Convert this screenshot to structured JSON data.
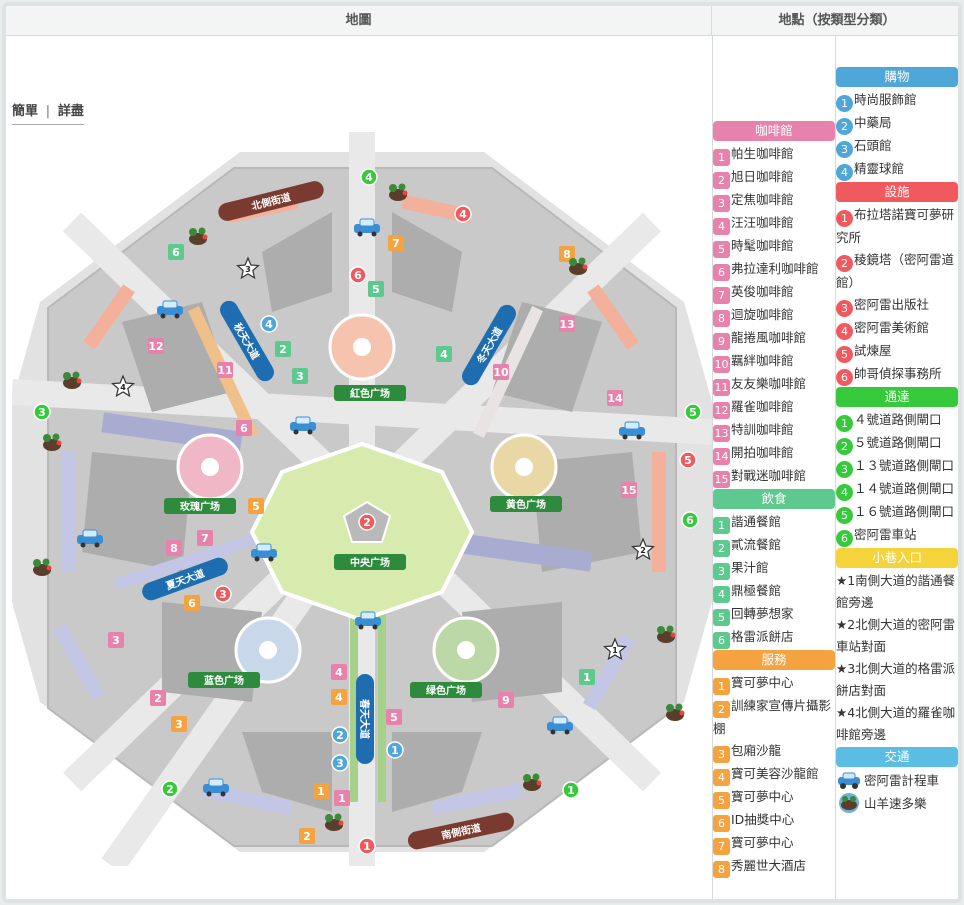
{
  "header": {
    "map_title": "地圖",
    "locations_title": "地點（按類型分類）"
  },
  "toggle": {
    "simple": "簡單",
    "sep": "|",
    "detail": "詳盡"
  },
  "map": {
    "plazas": {
      "red": "紅色广场",
      "yellow": "黄色广场",
      "rose": "玫瑰广场",
      "center": "中央广场",
      "blue": "蓝色广场",
      "green": "绿色广场"
    },
    "roads": {
      "north": "北側街道",
      "south": "南側街道",
      "autumn": "秋天大道",
      "winter": "冬天大道",
      "summer": "夏天大道",
      "spring": "春天大道"
    },
    "stars": [
      "1",
      "2",
      "3",
      "4"
    ]
  },
  "categories": [
    {
      "key": "cafe",
      "title": "咖啡館",
      "color": "#e682ab",
      "shape": "square",
      "items": [
        {
          "n": "1",
          "label": "帕生咖啡館"
        },
        {
          "n": "2",
          "label": "旭日咖啡館"
        },
        {
          "n": "3",
          "label": "定焦咖啡館"
        },
        {
          "n": "4",
          "label": "汪汪咖啡館"
        },
        {
          "n": "5",
          "label": "時髦咖啡館"
        },
        {
          "n": "6",
          "label": "弗拉達利咖啡館"
        },
        {
          "n": "7",
          "label": "英俊咖啡館"
        },
        {
          "n": "8",
          "label": "迴旋咖啡館"
        },
        {
          "n": "9",
          "label": "龍捲風咖啡館"
        },
        {
          "n": "10",
          "label": "羈絆咖啡館"
        },
        {
          "n": "11",
          "label": "友友樂咖啡館"
        },
        {
          "n": "12",
          "label": "羅雀咖啡館"
        },
        {
          "n": "13",
          "label": "特訓咖啡館"
        },
        {
          "n": "14",
          "label": "開拍咖啡館"
        },
        {
          "n": "15",
          "label": "對戰迷咖啡館"
        }
      ]
    },
    {
      "key": "food",
      "title": "飲食",
      "color": "#5ec98e",
      "shape": "square",
      "items": [
        {
          "n": "1",
          "label": "諧通餐館"
        },
        {
          "n": "2",
          "label": "貳流餐館"
        },
        {
          "n": "3",
          "label": "果汁館"
        },
        {
          "n": "4",
          "label": "鼎極餐館"
        },
        {
          "n": "5",
          "label": "回轉夢想家"
        },
        {
          "n": "6",
          "label": "格雷派餅店"
        }
      ]
    },
    {
      "key": "service",
      "title": "服務",
      "color": "#f4a340",
      "shape": "square",
      "items": [
        {
          "n": "1",
          "label": "寶可夢中心"
        },
        {
          "n": "2",
          "label": "訓練家宣傳片攝影棚"
        },
        {
          "n": "3",
          "label": "包廂沙龍"
        },
        {
          "n": "4",
          "label": "寶可美容沙龍館"
        },
        {
          "n": "5",
          "label": "寶可夢中心"
        },
        {
          "n": "6",
          "label": "ID抽獎中心"
        },
        {
          "n": "7",
          "label": "寶可夢中心"
        },
        {
          "n": "8",
          "label": "秀麗世大酒店"
        }
      ]
    },
    {
      "key": "shop",
      "title": "購物",
      "color": "#4fa6d8",
      "shape": "circle",
      "items": [
        {
          "n": "1",
          "label": "時尚服飾館"
        },
        {
          "n": "2",
          "label": "中藥局"
        },
        {
          "n": "3",
          "label": "石頭館"
        },
        {
          "n": "4",
          "label": "精靈球館"
        }
      ]
    },
    {
      "key": "facility",
      "title": "設施",
      "color": "#f05a5f",
      "shape": "circle",
      "items": [
        {
          "n": "1",
          "label": "布拉塔諾寶可夢研究所"
        },
        {
          "n": "2",
          "label": "稜鏡塔（密阿雷道館）"
        },
        {
          "n": "3",
          "label": "密阿雷出版社"
        },
        {
          "n": "4",
          "label": "密阿雷美術館"
        },
        {
          "n": "5",
          "label": "試煉屋"
        },
        {
          "n": "6",
          "label": "帥哥偵探事務所"
        }
      ]
    },
    {
      "key": "gate",
      "title": "通達",
      "color": "#36c93b",
      "shape": "circle",
      "items": [
        {
          "n": "1",
          "label": "４號道路側閘口"
        },
        {
          "n": "2",
          "label": "５號道路側閘口"
        },
        {
          "n": "3",
          "label": "１３號道路側閘口"
        },
        {
          "n": "4",
          "label": "１４號道路側閘口"
        },
        {
          "n": "5",
          "label": "１６號道路側閘口"
        },
        {
          "n": "6",
          "label": "密阿雷車站"
        }
      ]
    },
    {
      "key": "alley",
      "title": "小巷入口",
      "color": "#f5d33a",
      "shape": "none",
      "items": [
        {
          "n": "",
          "label": "★1南側大道的諧通餐館旁邊"
        },
        {
          "n": "",
          "label": "★2北側大道的密阿雷車站對面"
        },
        {
          "n": "",
          "label": "★3北側大道的格雷派餅店對面"
        },
        {
          "n": "",
          "label": "★4北側大道的羅雀咖啡館旁邊"
        }
      ]
    },
    {
      "key": "transport",
      "title": "交通",
      "color": "#5bbde4",
      "shape": "none",
      "items": [
        {
          "n": "",
          "label": "密阿雷計程車",
          "icon": "taxi-icon"
        },
        {
          "n": "",
          "label": "山羊速多樂",
          "icon": "gogoat-icon"
        }
      ]
    }
  ],
  "colors": {
    "cafe": "#e682ab",
    "food": "#5ec98e",
    "service": "#f4a340",
    "shop": "#4fa6d8",
    "facility": "#f05a5f",
    "gate": "#36c93b",
    "alley": "#f5d33a",
    "transport": "#5bbde4"
  }
}
